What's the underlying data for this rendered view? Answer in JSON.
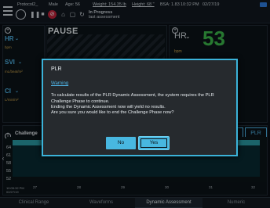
{
  "topbar": {
    "patient": "Protocol2_",
    "sex": "Male",
    "age": "Age: 56",
    "weight": "Weight: 154.35 lb",
    "height": "Height: 68 \"",
    "bsa": "BSA: 1.83",
    "time": "10:32 PM",
    "date": "02/27/19",
    "status_line1": "In Progress",
    "status_line2": "last assessment"
  },
  "left_panel": {
    "hr_label": "HR",
    "hr_unit": "bpm",
    "svi_label": "SVI",
    "svi_unit": "mL/beat/m²",
    "ci_label": "CI",
    "ci_unit": "L/min/m²"
  },
  "pause_label": "PAUSE",
  "right_panel": {
    "hr_label": "HR",
    "hr_value": "53",
    "hr_unit": "bpm"
  },
  "challenge": {
    "label": "Challenge",
    "y_ticks": [
      "64",
      "61",
      "58",
      "55",
      "52"
    ],
    "x_ticks": [
      "27",
      "28",
      "29",
      "30",
      "31",
      "32"
    ],
    "timestamp_line1": "10:05:32 PM",
    "timestamp_line2": "02/27/19",
    "right_chip_1": "s",
    "right_chip_2": "PLR"
  },
  "bottom_nav": {
    "tabs": [
      "Clinical Range",
      "Waveforms",
      "Dynamic Assessment",
      "Numeric"
    ],
    "active": "Dynamic Assessment"
  },
  "dialog": {
    "title": "PLR",
    "warning": "Warning",
    "message1": "To calculate results of the PLR Dynamic Assessment, the system requires the PLR Challenge Phase to continue.",
    "message2": "Ending the Dynamic Assessment now will yield no results.",
    "message3": "Are you sure you would like to end the Challenge Phase now?",
    "no_label": "No",
    "yes_label": "Yes"
  },
  "colors": {
    "accent": "#4fb4e6",
    "hr_value": "#3cb94b",
    "stop": "#c0223a"
  }
}
